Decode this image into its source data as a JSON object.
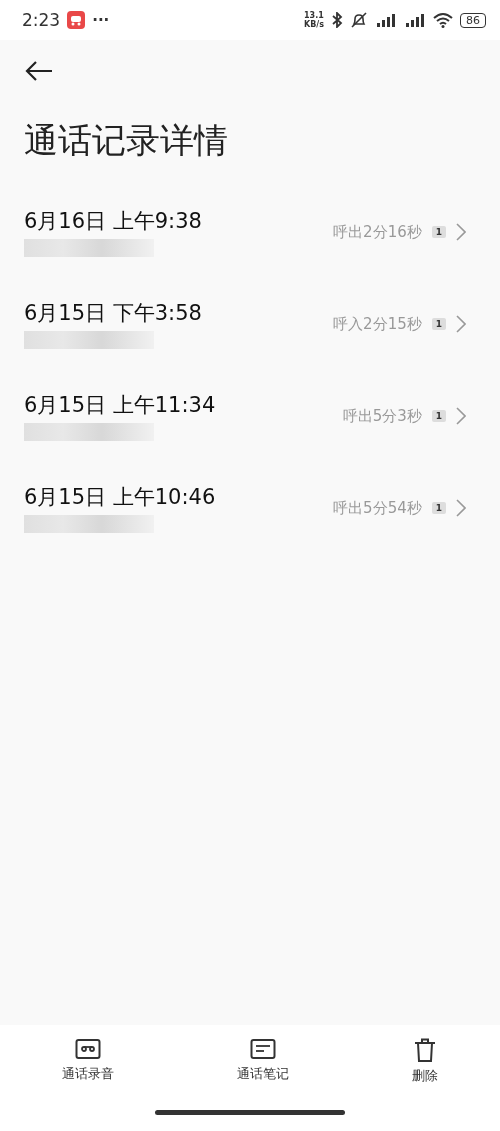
{
  "status_bar": {
    "time": "2:23",
    "more": "···",
    "speed_value": "13.1",
    "speed_unit": "KB/s",
    "battery": "86"
  },
  "title": "通话记录详情",
  "calls": [
    {
      "datetime": "6月16日 上午9:38",
      "summary": "呼出2分16秒",
      "badge": "1"
    },
    {
      "datetime": "6月15日 下午3:58",
      "summary": "呼入2分15秒",
      "badge": "1"
    },
    {
      "datetime": "6月15日 上午11:34",
      "summary": "呼出5分3秒",
      "badge": "1"
    },
    {
      "datetime": "6月15日 上午10:46",
      "summary": "呼出5分54秒",
      "badge": "1"
    }
  ],
  "bottom_actions": [
    {
      "kind": "recording",
      "label": "通话录音"
    },
    {
      "kind": "notes",
      "label": "通话笔记"
    },
    {
      "kind": "delete",
      "label": "删除"
    }
  ]
}
